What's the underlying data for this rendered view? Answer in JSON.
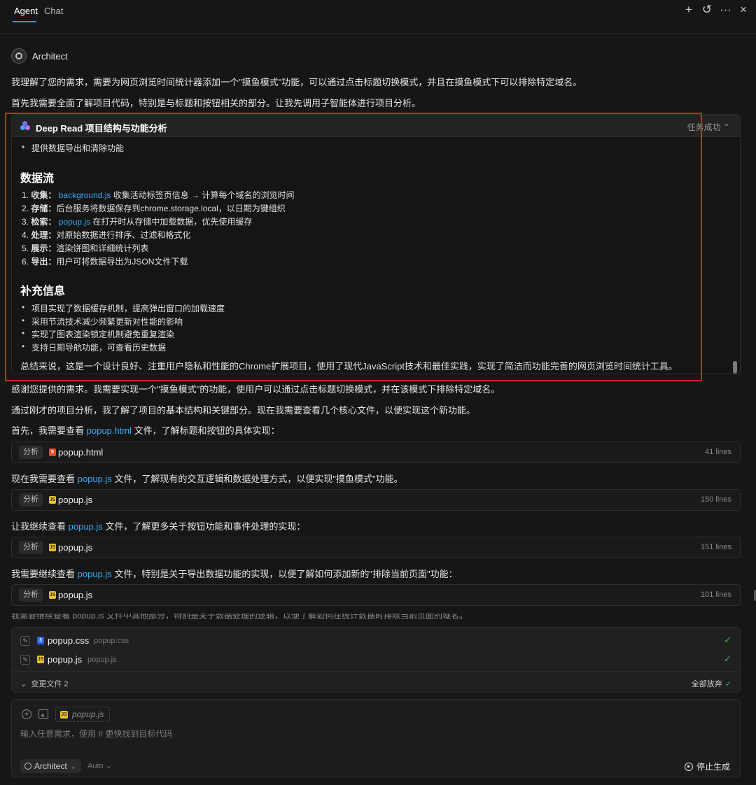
{
  "tabs": [
    {
      "label": "Agent"
    },
    {
      "label": "Chat"
    }
  ],
  "top_icons": [
    "plus-icon",
    "history-icon",
    "more-icon",
    "close-icon"
  ],
  "architect": {
    "name": "Architect"
  },
  "messages": {
    "m1": "我理解了您的需求，需要为网页浏览时间统计器添加一个\"摸鱼模式\"功能，可以通过点击标题切换模式，并且在摸鱼模式下可以排除特定域名。",
    "m2": "首先我需要全面了解项目代码，特别是与标题和按钮相关的部分。让我先调用子智能体进行项目分析。",
    "m3": "感谢您提供的需求。我需要实现一个\"摸鱼模式\"的功能，使用户可以通过点击标题切换模式，并在该模式下排除特定域名。",
    "m4": "通过刚才的项目分析，我了解了项目的基本结构和关键部分。现在我需要查看几个核心文件，以便实现这个新功能。",
    "m5_pre": "首先，我需要查看 ",
    "m5_link": "popup.html",
    "m5_post": " 文件，了解标题和按钮的具体实现：",
    "m6_pre": "现在我需要查看 ",
    "m6_link": "popup.js",
    "m6_post": " 文件，了解现有的交互逻辑和数据处理方式，以便实现\"摸鱼模式\"功能。",
    "m7_pre": "让我继续查看 ",
    "m7_link": "popup.js",
    "m7_post": " 文件，了解更多关于按钮功能和事件处理的实现：",
    "m8_pre": "我需要继续查看 ",
    "m8_link": "popup.js",
    "m8_post": " 文件，特别是关于导出数据功能的实现，以便了解如何添加新的\"排除当前页面\"功能：",
    "m9_faded": "我需要继续查看 popup.js 文件中其他部分，特别是关于数据处理的逻辑，以便了解如何在统计数据时排除当前页面的域名。"
  },
  "deep_read": {
    "title": "Deep Read 项目结构与功能分析",
    "status": "任务成功",
    "top_bullet": "提供数据导出和清除功能",
    "section1": "数据流",
    "flow": [
      {
        "num": "1.",
        "key": "收集：",
        "link": "background.js",
        "text": " 收集活动标签页信息 → 计算每个域名的浏览时间"
      },
      {
        "num": "2.",
        "key": "存储：",
        "link": "",
        "text": "后台服务将数据保存到chrome.storage.local，以日期为键组织"
      },
      {
        "num": "3.",
        "key": "检索：",
        "link": "popup.js",
        "text": " 在打开时从存储中加载数据，优先使用缓存"
      },
      {
        "num": "4.",
        "key": "处理：",
        "link": "",
        "text": "对原始数据进行排序、过滤和格式化"
      },
      {
        "num": "5.",
        "key": "展示：",
        "link": "",
        "text": "渲染饼图和详细统计列表"
      },
      {
        "num": "6.",
        "key": "导出：",
        "link": "",
        "text": "用户可将数据导出为JSON文件下载"
      }
    ],
    "section2": "补充信息",
    "extra": [
      "项目实现了数据缓存机制，提高弹出窗口的加载速度",
      "采用节流技术减少频繁更新对性能的影响",
      "实现了图表渲染锁定机制避免重复渲染",
      "支持日期导航功能，可查看历史数据"
    ],
    "summary": "总结来说，这是一个设计良好、注重用户隐私和性能的Chrome扩展项目，使用了现代JavaScript技术和最佳实践，实现了简洁而功能完善的网页浏览时间统计工具。"
  },
  "cards": [
    {
      "tag": "分析",
      "file": "popup.html",
      "lines": "41 lines",
      "type": "html"
    },
    {
      "tag": "分析",
      "file": "popup.js",
      "lines": "150 lines",
      "type": "js"
    },
    {
      "tag": "分析",
      "file": "popup.js",
      "lines": "151 lines",
      "type": "js"
    },
    {
      "tag": "分析",
      "file": "popup.js",
      "lines": "101 lines",
      "type": "js"
    }
  ],
  "changes": {
    "files": [
      {
        "name": "popup.css",
        "path": "popup.css"
      },
      {
        "name": "popup.js",
        "path": "popup.js"
      }
    ],
    "toggle_label": "变更文件 2",
    "discard_label": "全部放弃"
  },
  "composer": {
    "chip_file": "popup.js",
    "placeholder": "输入任意需求，使用 # 更快找到目标代码",
    "mode": "Architect",
    "model": "Auto",
    "stop_label": "停止生成"
  },
  "colors": {
    "accent": "#3b8fe3",
    "link": "#3aa8f2",
    "highlight": "#e0202a",
    "success": "#4caf50"
  }
}
